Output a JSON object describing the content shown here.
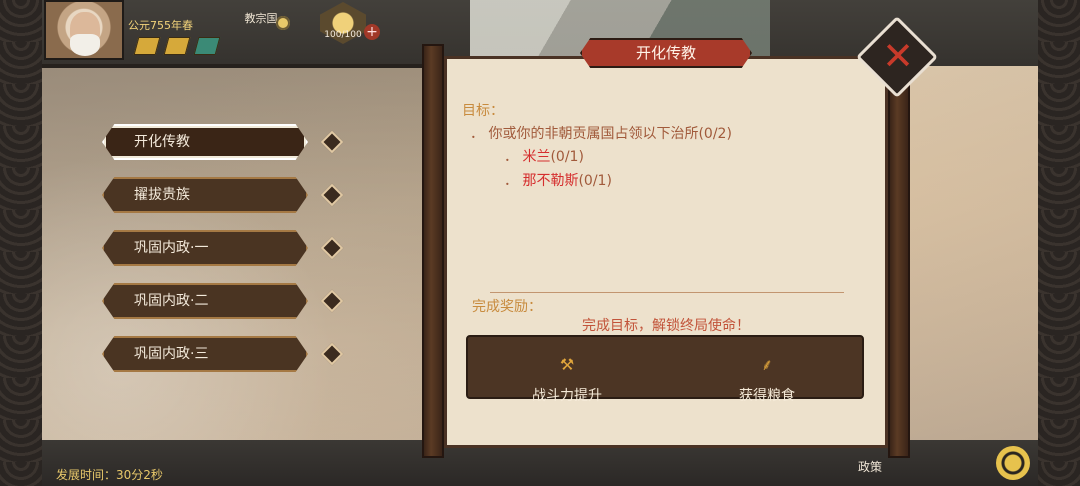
{
  "hud": {
    "era": "公元755年春",
    "religion": "教宗国",
    "army_count": "100/100",
    "army_plus": "+",
    "dev_time": "发展时间：30分2秒",
    "policy": "政策"
  },
  "nav": {
    "items": [
      {
        "label": "开化传教",
        "active": true
      },
      {
        "label": "擢拔贵族",
        "active": false
      },
      {
        "label": "巩固内政·一",
        "active": false
      },
      {
        "label": "巩固内政·二",
        "active": false
      },
      {
        "label": "巩固内政·三",
        "active": false
      }
    ]
  },
  "modal": {
    "title": "开化传教",
    "goal_label": "目标：",
    "goal_main": "．  你或你的非朝贡属国占领以下治所(0/2)",
    "goals": [
      {
        "bullet": "．",
        "city": "米兰",
        "count": "(0/1)"
      },
      {
        "bullet": "．",
        "city": "那不勒斯",
        "count": "(0/1)"
      }
    ],
    "reward_label": "完成奖励：",
    "reward_note": "完成目标，解锁终局使命！",
    "rewards": [
      {
        "icon": "combat-icon",
        "label": "战斗力提升"
      },
      {
        "icon": "grain-icon",
        "label": "获得粮食"
      }
    ],
    "close_symbol": "✕"
  },
  "colors": {
    "title_bar": "#a83a2a",
    "panel_bg": "#ede1cc",
    "goal_label": "#c88b3e",
    "city_red": "#d52e2e",
    "reward_box": "#4c3524"
  }
}
